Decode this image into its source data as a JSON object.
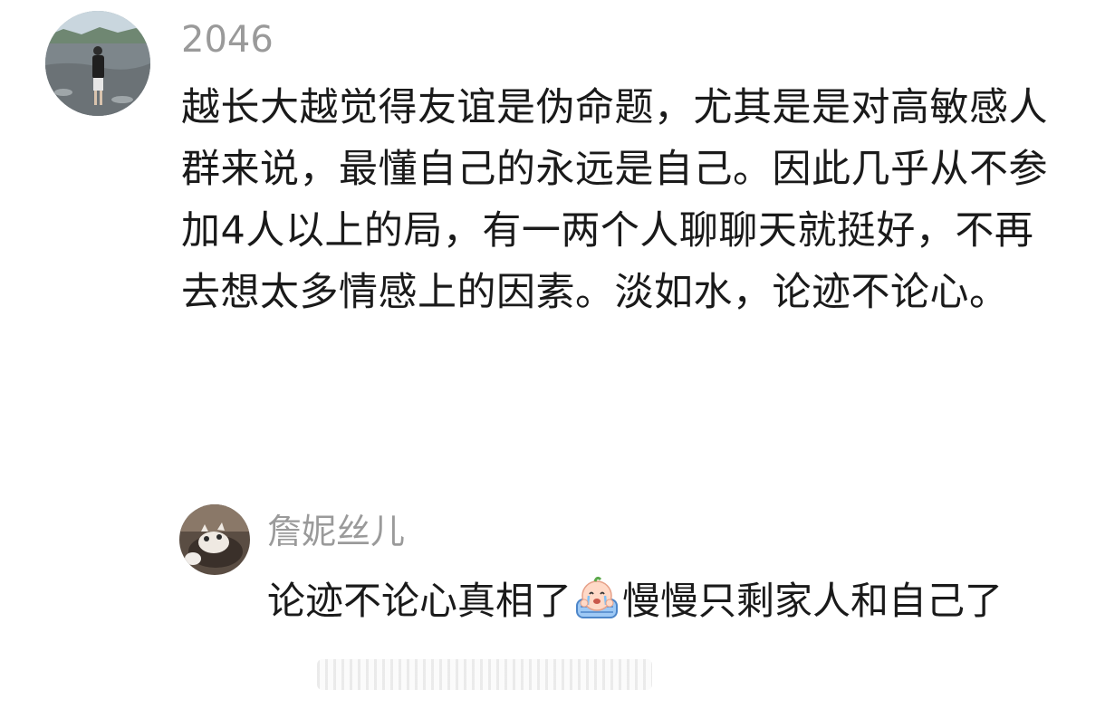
{
  "main_comment": {
    "username": "2046",
    "text": "越长大越觉得友谊是伪命题，尤其是是对高敏感人群来说，最懂自己的永远是自己。因此几乎从不参加4人以上的局，有一两个人聊聊天就挺好，不再去想太多情感上的因素。淡如水，论迹不论心。",
    "avatar_icon": "avatar-photo-person-by-river"
  },
  "reply": {
    "username": "詹妮丝儿",
    "text_before_emoji": "论迹不论心真相了",
    "emoji_icon": "crying-face-emoji",
    "text_after_emoji": "慢慢只剩家人和自己了",
    "avatar_icon": "avatar-photo-cat"
  },
  "colors": {
    "username": "#9a9a9a",
    "body_text": "#1a1a1a",
    "background": "#ffffff"
  }
}
